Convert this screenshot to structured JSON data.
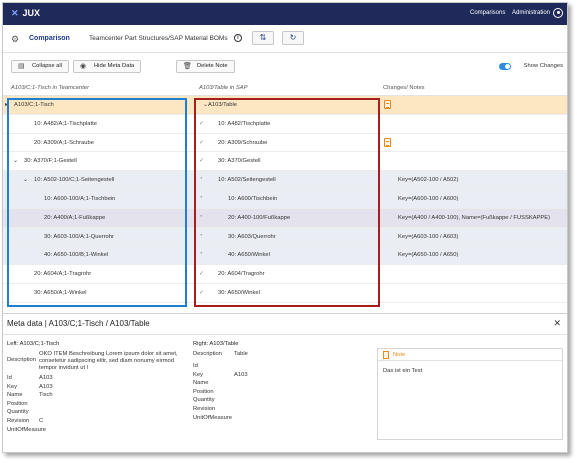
{
  "topbar": {
    "logo": "JUX",
    "logo_mark": "✕",
    "nav": [
      "Comparisons",
      "Administration"
    ],
    "user_icon": "user-circle-icon"
  },
  "subhead": {
    "title": "Comparison",
    "breadcrumb": "Teamcenter Part Structures/SAP Material BOMs",
    "info": "i",
    "icons": [
      "transfer-icon",
      "refresh-icon"
    ]
  },
  "toolbar": {
    "collapse_all": "Collapse all",
    "hide_meta": "Hide Meta Data",
    "delete_note": "Delete Note",
    "show_changes": "Show Changes"
  },
  "columns": {
    "left": "A103/C;1-Tisch in Teamcenter",
    "right": "A103/Table in SAP",
    "notes": "Changes/ Notes"
  },
  "rows": [
    {
      "left": "A103/C;1-Tisch",
      "right": "A103/Table",
      "note": "",
      "doc": true,
      "style": "hl"
    },
    {
      "left": "10: A482/A;1-Tischplatte",
      "right": "10: A482/Tischplatte",
      "note": "",
      "doc": false,
      "style": ""
    },
    {
      "left": "20: A309/A;1-Schraube",
      "right": "20: A309/Schraube",
      "note": "",
      "doc": true,
      "style": ""
    },
    {
      "left": "30: A370/F;1-Gestell",
      "right": "30: A370/Gestell",
      "note": "",
      "doc": false,
      "style": ""
    },
    {
      "left": "10: A502-100/C;1-Seitengestell",
      "right": "10: A502/Seitengestell",
      "note": "Key=(A502-100 / A502)",
      "doc": false,
      "style": "b1"
    },
    {
      "left": "10: A600-100/A;1-Tischbein",
      "right": "10: A600/Tischbein",
      "note": "Key=(A600-100 / A600)",
      "doc": false,
      "style": "b1"
    },
    {
      "left": "20: A400/A;1-Fußkappe",
      "right": "20: A400-100/Fußkappe",
      "note": "Key=(A400 / A400-100), Name=(Fußkappe / FUSSKAPPE)",
      "doc": false,
      "style": "b3"
    },
    {
      "left": "30: A603-100/A;1-Querrohr",
      "right": "30: A603/Querrohr",
      "note": "Key=(A603-100 / A603)",
      "doc": false,
      "style": "b1"
    },
    {
      "left": "40: A650-100/B;1-Winkel",
      "right": "40: A650/Winkel",
      "note": "Key=(A650-100 / A650)",
      "doc": false,
      "style": "b1"
    },
    {
      "left": "20: A604/A;1-Tragrohr",
      "right": "20: A604/Tragrohr",
      "note": "",
      "doc": false,
      "style": ""
    },
    {
      "left": "30: A650/A;1-Winkel",
      "right": "30: A650/Winkel",
      "note": "",
      "doc": false,
      "style": ""
    }
  ],
  "meta": {
    "title": "Meta data | A103/C;1-Tisch / A103/Table",
    "left_header": "Left: A103/C;1-Tisch",
    "right_header": "Right: A103/Table",
    "left_labels": [
      "Description",
      "Id",
      "Key",
      "Name",
      "Position",
      "Quantity",
      "Revision",
      "UnitOfMeasure"
    ],
    "left_values": [
      "OKO ITEM Beschreibung Lorem ipsum dolor sit amet, consetetur sadipscing elitr, sed diam nonumy eirmod tempor invidunt ut l",
      "A103",
      "A103",
      "Tisch",
      "",
      "",
      "C",
      ""
    ],
    "right_labels": [
      "Description",
      "Id",
      "Key",
      "Name",
      "Position",
      "Quantity",
      "Revision",
      "UnitOfMeasure"
    ],
    "right_values": [
      "Table",
      "",
      "A103",
      "",
      "",
      "",
      "",
      ""
    ],
    "note_label": "Note",
    "note_text": "Das ist ein Test"
  }
}
